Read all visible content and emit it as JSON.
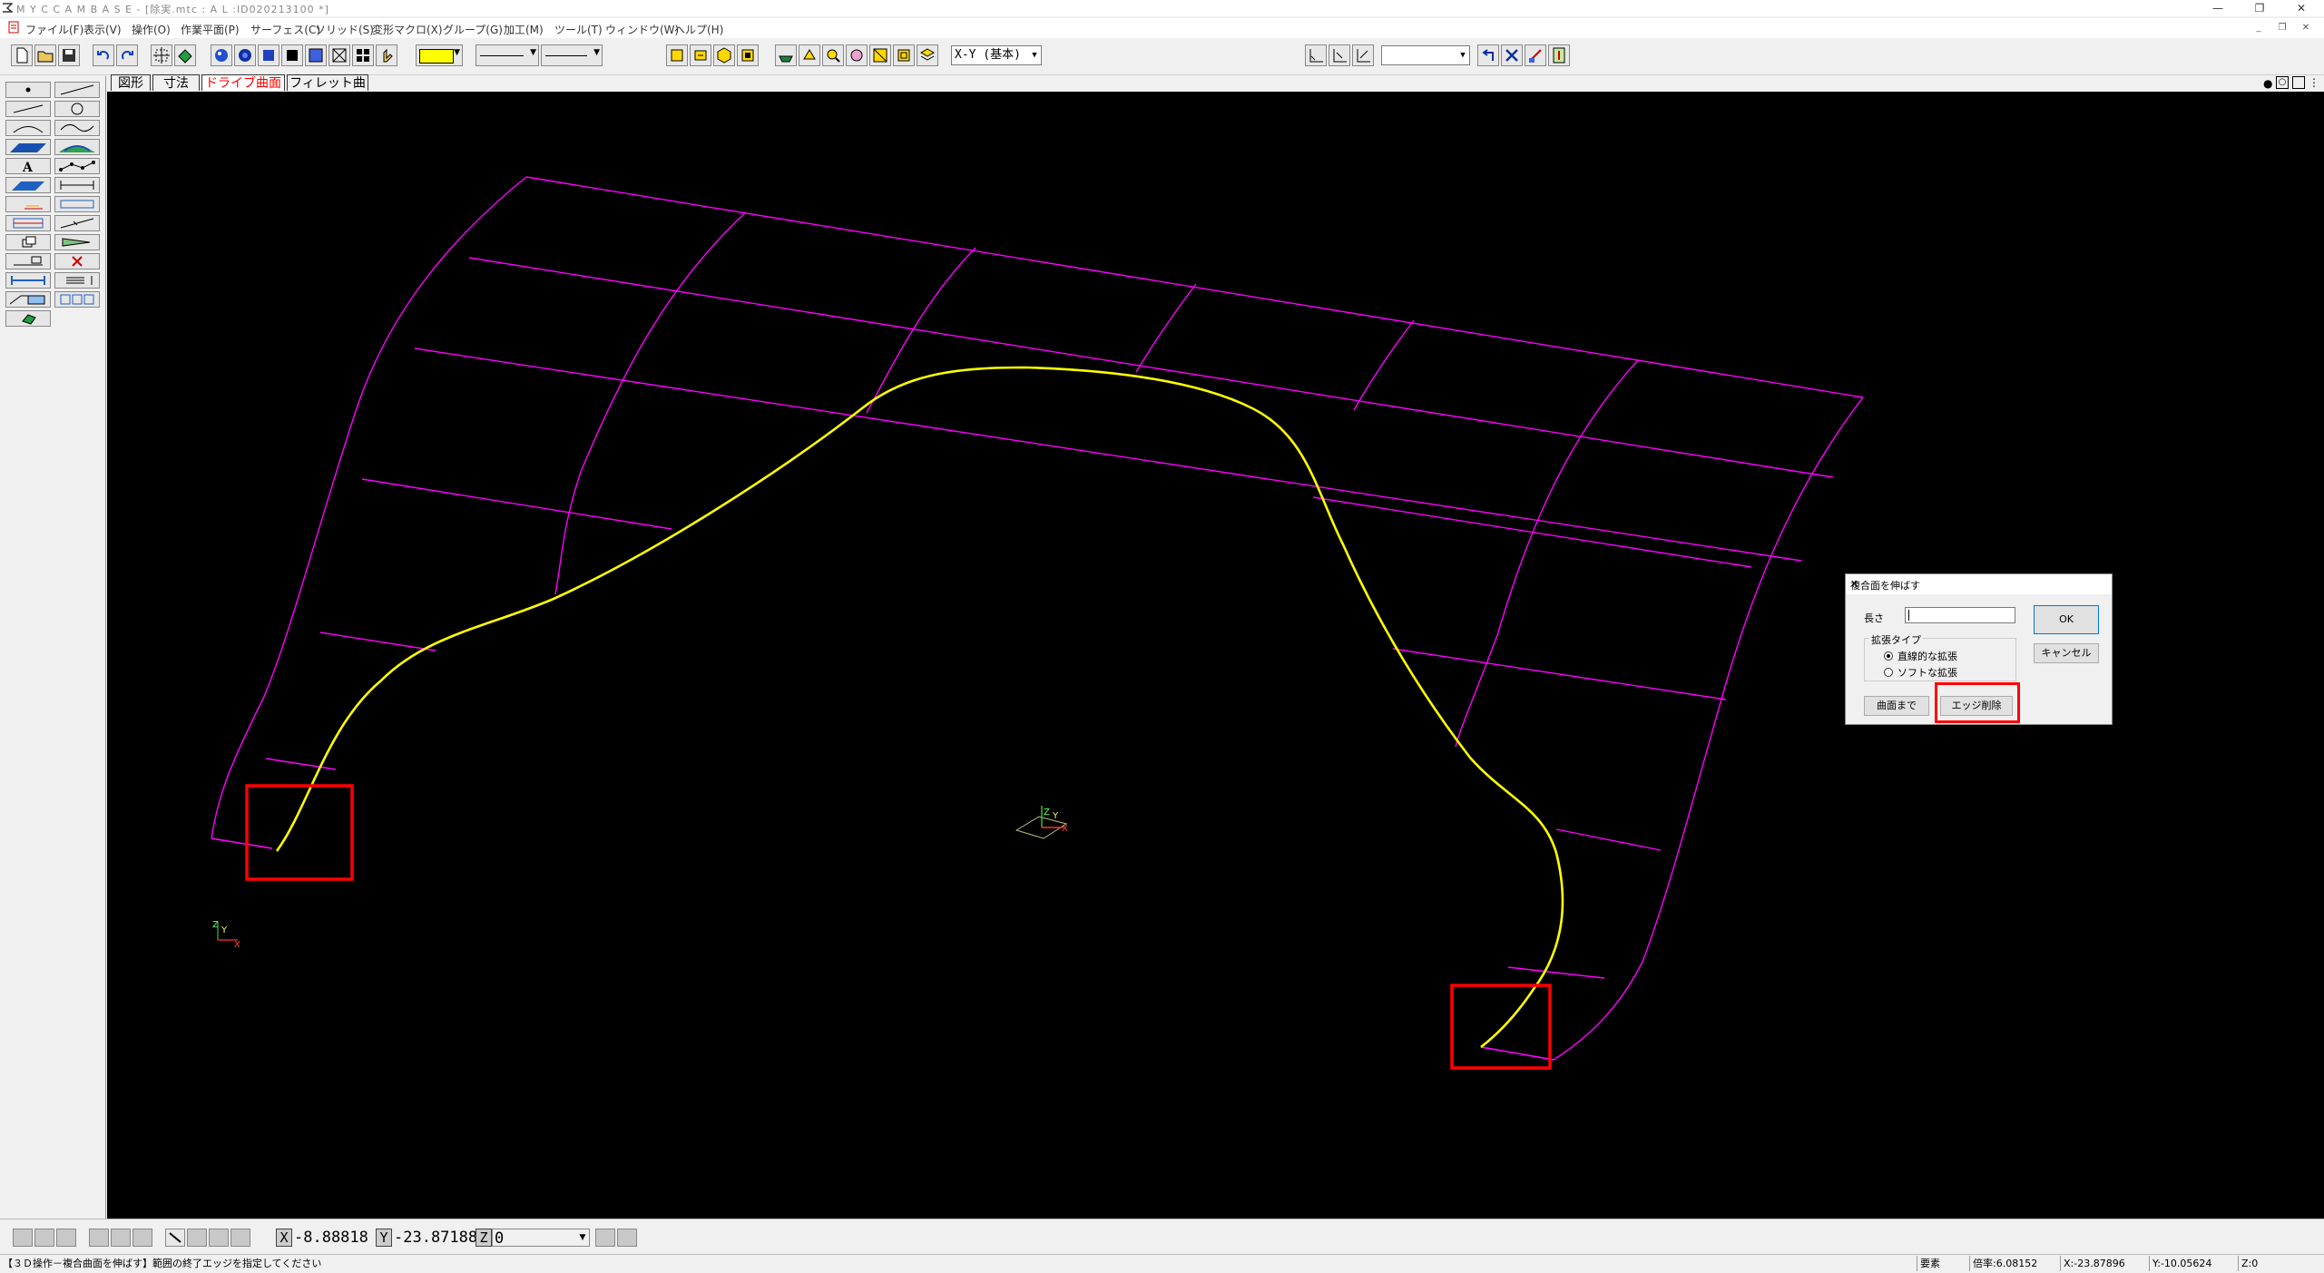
{
  "app": {
    "title": "M Y C  C A M B A S E - [除実.mtc : A L  :ID020213100 *]"
  },
  "menu": [
    "ファイル(F)",
    "表示(V)",
    "操作(O)",
    "作業平面(P)",
    "サーフェス(C)",
    "ソリッド(S)",
    "変形マクロ(X)",
    "グループ(G)",
    "加工(M)",
    "ツール(T)",
    "ウィンドウ(W)",
    "ヘルプ(H)"
  ],
  "toolbar": {
    "color_swatch": "#ffff00",
    "plane_select": "X-Y (基本)"
  },
  "tabs": [
    "図形",
    "寸法",
    "ドライブ曲面",
    "フィレット曲面"
  ],
  "dialog": {
    "title": "複合面を伸ばす",
    "length_label": "長さ",
    "length_value": "",
    "ok": "OK",
    "cancel": "キャンセル",
    "group_label": "拡張タイプ",
    "radio_linear": "直線的な拡張",
    "radio_soft": "ソフトな拡張",
    "to_surface": "曲面まで",
    "edge_delete": "エッジ削除"
  },
  "coords": {
    "x_label": "X",
    "x_value": "-8.88818",
    "y_label": "Y",
    "y_value": "-23.87188",
    "z_label": "Z",
    "z_value": "0"
  },
  "status": {
    "message": "【３Ｄ操作－複合曲面を伸ばす】範囲の終了エッジを指定してください",
    "mode": "要素",
    "zoom": "倍率:6.08152",
    "x": "X:-23.87896",
    "y": "Y:-10.05624",
    "z": "Z:0"
  },
  "colors": {
    "mesh": "#ff00ff",
    "curve": "#ffff00",
    "highlight": "#ff0000",
    "canvas": "#000000"
  }
}
